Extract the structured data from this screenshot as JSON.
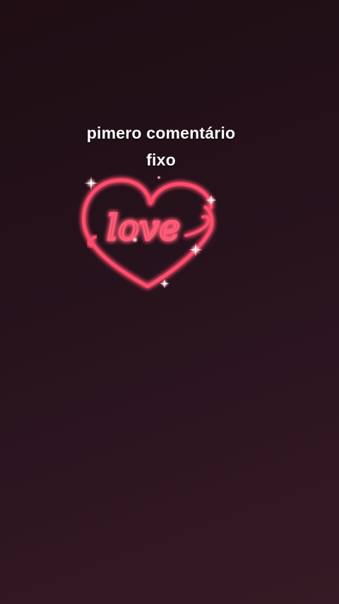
{
  "caption": {
    "line1": "pimero comentário",
    "line2": "fixo"
  },
  "sticker": {
    "word": "love",
    "icon": "neon-heart-icon"
  },
  "colors": {
    "neon": "#ff4d6d",
    "glow": "#ff2a55",
    "background_top": "#1f0e14",
    "background_bottom": "#361a25"
  }
}
